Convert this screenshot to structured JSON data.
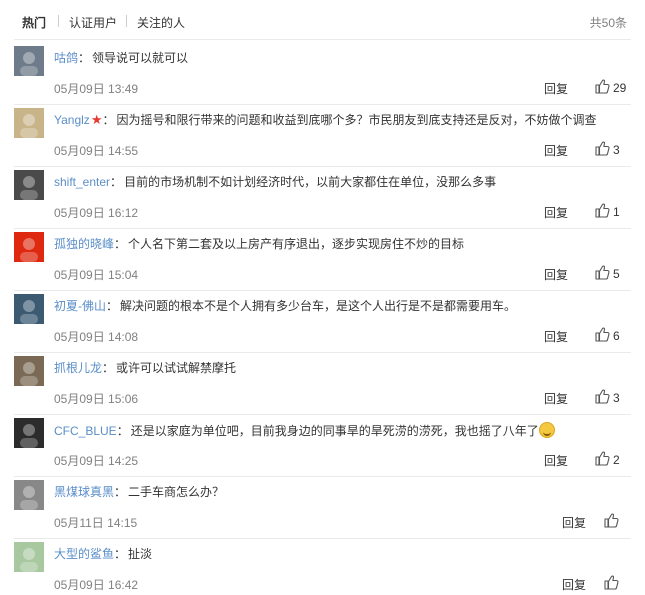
{
  "tabs": {
    "hot": "热门",
    "verified": "认证用户",
    "followed": "关注的人",
    "total": "共50条"
  },
  "reply_label": "回复",
  "comments": [
    {
      "user": "咕鸽",
      "text": "领导说可以就可以",
      "time": "05月09日 13:49",
      "likes": "29",
      "avatar_bg": "#6e7b8a"
    },
    {
      "user": "Yanglz",
      "text": "因为摇号和限行带来的问题和收益到底哪个多？市民朋友到底支持还是反对，不妨做个调查",
      "time": "05月09日 14:55",
      "likes": "3",
      "avatar_bg": "#c9b48a"
    },
    {
      "user": "shift_enter",
      "text": "目前的市场机制不如计划经济时代，以前大家都住在单位，没那么多事",
      "time": "05月09日 16:12",
      "likes": "1",
      "avatar_bg": "#4a4a4a"
    },
    {
      "user": "孤独的晓峰",
      "text": "个人名下第二套及以上房产有序退出，逐步实现房住不炒的目标",
      "time": "05月09日 15:04",
      "likes": "5",
      "avatar_bg": "#de2910"
    },
    {
      "user": "初夏-佛山",
      "text": "解决问题的根本不是个人拥有多少台车，是这个人出行是不是都需要用车。",
      "time": "05月09日 14:08",
      "likes": "6",
      "avatar_bg": "#3d5a73"
    },
    {
      "user": "抓根儿龙",
      "text": "或许可以试试解禁摩托",
      "time": "05月09日 15:06",
      "likes": "3",
      "avatar_bg": "#7a6a55"
    },
    {
      "user": "CFC_BLUE",
      "text": "还是以家庭为单位吧，目前我身边的同事旱的旱死涝的涝死，我也摇了八年了",
      "time": "05月09日 14:25",
      "likes": "2",
      "avatar_bg": "#2c2c2c"
    },
    {
      "user": "黑煤球真黑",
      "text": "二手车商怎么办？",
      "time": "05月11日 14:15",
      "likes": "",
      "avatar_bg": "#888888"
    },
    {
      "user": "大型的鲨鱼",
      "text": "扯淡",
      "time": "05月09日 16:42",
      "likes": "",
      "avatar_bg": "#a8c8a0"
    }
  ]
}
